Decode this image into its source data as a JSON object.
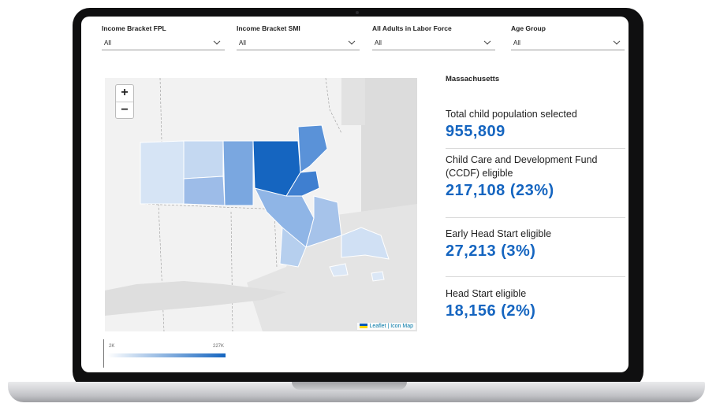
{
  "filters": [
    {
      "label": "Income Bracket FPL",
      "value": "All"
    },
    {
      "label": "Income Bracket SMI",
      "value": "All"
    },
    {
      "label": "All Adults in Labor Force",
      "value": "All"
    },
    {
      "label": "Age Group",
      "value": "All"
    }
  ],
  "map": {
    "zoom_in": "+",
    "zoom_out": "−",
    "attribution": "Leaflet | Icon Map",
    "legend": {
      "min": "2K",
      "max": "227K"
    },
    "colors": {
      "light": "#d3e3f5",
      "medium": "#7aa7e0",
      "dark": "#1565c0",
      "land": "#e6e6e6",
      "water": "#cfcfcf"
    }
  },
  "panel": {
    "region": "Massachusetts",
    "stats": [
      {
        "label": "Total child population selected",
        "value": "955,809"
      },
      {
        "label": "Child Care and Development Fund (CCDF) eligible",
        "value": "217,108 (23%)"
      },
      {
        "label": "Early Head Start eligible",
        "value": "27,213 (3%)"
      },
      {
        "label": "Head Start eligible",
        "value": "18,156 (2%)"
      }
    ],
    "accent": "#1565c0"
  }
}
